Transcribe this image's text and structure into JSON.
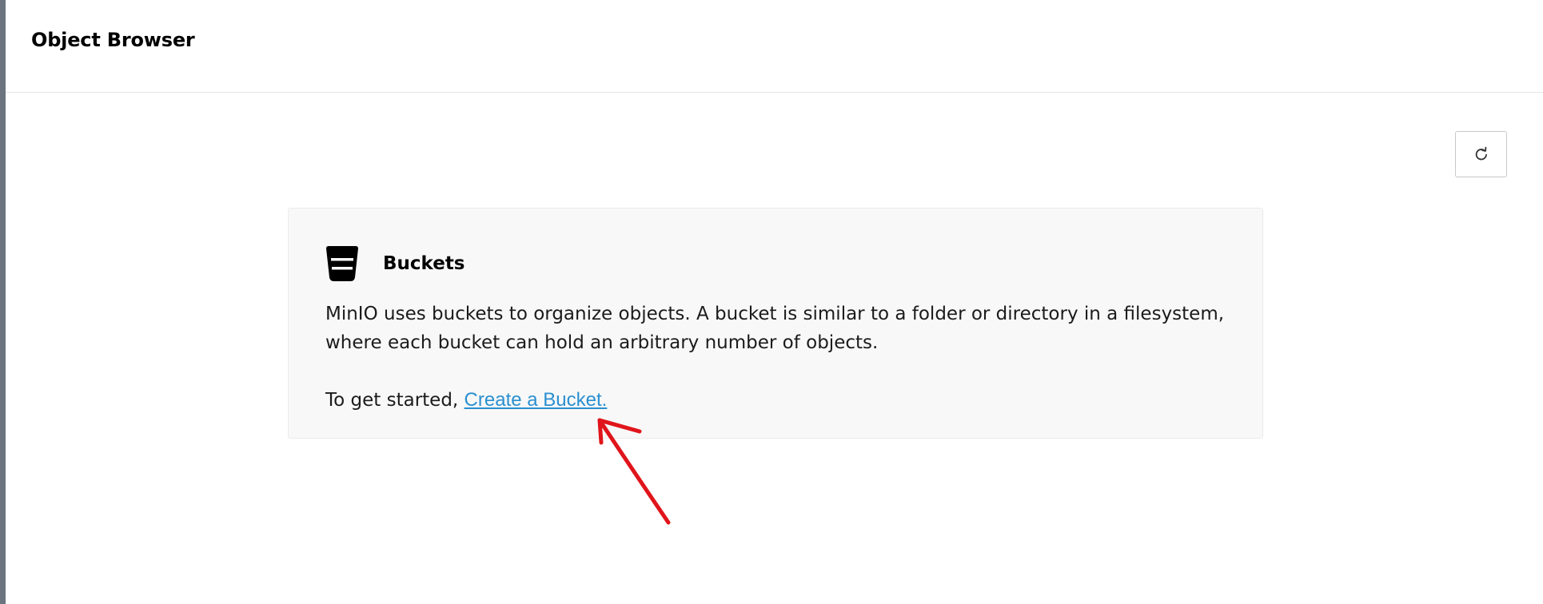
{
  "header": {
    "title": "Object Browser"
  },
  "toolbar": {
    "refresh_icon": "refresh-icon"
  },
  "empty_state": {
    "icon": "bucket-icon",
    "title": "Buckets",
    "description": "MinIO uses buckets to organize objects. A bucket is similar to a folder or directory in a filesystem, where each bucket can hold an arbitrary number of objects.",
    "cta_prefix": "To get started,",
    "cta_link": "Create a Bucket."
  },
  "colors": {
    "link": "#2a8fd0",
    "annotation": "#e0151b"
  }
}
